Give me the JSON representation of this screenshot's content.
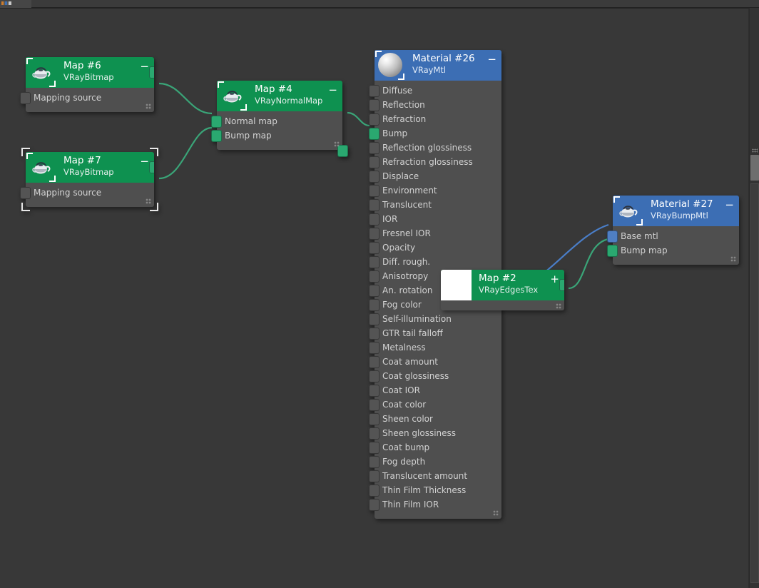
{
  "app": {
    "canvas_bg": "#383838",
    "accent_green": "#0e9150",
    "accent_blue": "#3c6eb4",
    "socket_green": "#2aa870",
    "socket_blue": "#4f7fc4",
    "socket_gray": "#545454",
    "wire_green": "#3aa578",
    "wire_blue": "#4a7ec8",
    "body_bg": "#4f4f4f"
  },
  "nodes": {
    "map6": {
      "title": "Map #6",
      "subtitle": "VRayBitmap",
      "collapse_glyph": "−",
      "icon": "teapot-icon",
      "slots": [
        {
          "label": "Mapping source",
          "socket": "gray",
          "side": "in"
        }
      ],
      "output_socket": "green",
      "selected": false
    },
    "map7": {
      "title": "Map #7",
      "subtitle": "VRayBitmap",
      "collapse_glyph": "−",
      "icon": "teapot-icon",
      "slots": [
        {
          "label": "Mapping source",
          "socket": "gray",
          "side": "in"
        }
      ],
      "output_socket": "green",
      "selected": true
    },
    "map4": {
      "title": "Map #4",
      "subtitle": "VRayNormalMap",
      "collapse_glyph": "−",
      "icon": "teapot-icon",
      "slots": [
        {
          "label": "Normal map",
          "socket": "green",
          "side": "in"
        },
        {
          "label": "Bump map",
          "socket": "green",
          "side": "in"
        }
      ],
      "output_socket": "green",
      "selected": false
    },
    "mat26": {
      "title": "Material #26",
      "subtitle": "VRayMtl",
      "collapse_glyph": "−",
      "icon": "sphere-preview-icon",
      "slots": [
        {
          "label": "Diffuse",
          "socket": "gray"
        },
        {
          "label": "Reflection",
          "socket": "gray"
        },
        {
          "label": "Refraction",
          "socket": "gray"
        },
        {
          "label": "Bump",
          "socket": "green"
        },
        {
          "label": "Reflection glossiness",
          "socket": "gray"
        },
        {
          "label": "Refraction glossiness",
          "socket": "gray"
        },
        {
          "label": "Displace",
          "socket": "gray"
        },
        {
          "label": "Environment",
          "socket": "gray"
        },
        {
          "label": "Translucent",
          "socket": "gray"
        },
        {
          "label": "IOR",
          "socket": "gray"
        },
        {
          "label": "Fresnel IOR",
          "socket": "gray"
        },
        {
          "label": "Opacity",
          "socket": "gray"
        },
        {
          "label": "Diff. rough.",
          "socket": "gray"
        },
        {
          "label": "Anisotropy",
          "socket": "gray"
        },
        {
          "label": "An. rotation",
          "socket": "gray"
        },
        {
          "label": "Fog color",
          "socket": "gray"
        },
        {
          "label": "Self-illumination",
          "socket": "gray"
        },
        {
          "label": "GTR tail falloff",
          "socket": "gray"
        },
        {
          "label": "Metalness",
          "socket": "gray"
        },
        {
          "label": "Coat amount",
          "socket": "gray"
        },
        {
          "label": "Coat glossiness",
          "socket": "gray"
        },
        {
          "label": "Coat IOR",
          "socket": "gray"
        },
        {
          "label": "Coat color",
          "socket": "gray"
        },
        {
          "label": "Sheen color",
          "socket": "gray"
        },
        {
          "label": "Sheen glossiness",
          "socket": "gray"
        },
        {
          "label": "Coat bump",
          "socket": "gray"
        },
        {
          "label": "Fog depth",
          "socket": "gray"
        },
        {
          "label": "Translucent amount",
          "socket": "gray"
        },
        {
          "label": "Thin Film Thickness",
          "socket": "gray"
        },
        {
          "label": "Thin Film IOR",
          "socket": "gray"
        }
      ],
      "output_socket": "blue",
      "selected": false
    },
    "map2": {
      "title": "Map #2",
      "subtitle": "VRayEdgesTex",
      "collapse_glyph": "+",
      "icon": "white-swatch-icon",
      "slots": [],
      "output_socket": "green",
      "selected": false
    },
    "mat27": {
      "title": "Material #27",
      "subtitle": "VRayBumpMtl",
      "collapse_glyph": "−",
      "icon": "teapot-icon",
      "slots": [
        {
          "label": "Base mtl",
          "socket": "blue"
        },
        {
          "label": "Bump map",
          "socket": "green"
        }
      ],
      "output_socket": null,
      "selected": false
    }
  },
  "connections": [
    {
      "from": "map6",
      "from_port": "out",
      "to": "map4",
      "to_port": "Normal map",
      "color": "green"
    },
    {
      "from": "map7",
      "from_port": "out",
      "to": "map4",
      "to_port": "Bump map",
      "color": "green"
    },
    {
      "from": "map4",
      "from_port": "out",
      "to": "mat26",
      "to_port": "Bump",
      "color": "green"
    },
    {
      "from": "mat26",
      "from_port": "out",
      "to": "mat27",
      "to_port": "Base mtl",
      "color": "blue"
    },
    {
      "from": "map2",
      "from_port": "out",
      "to": "mat27",
      "to_port": "Bump map",
      "color": "green"
    }
  ],
  "scrollbar": {
    "orientation": "vertical",
    "thumb_label": ""
  }
}
